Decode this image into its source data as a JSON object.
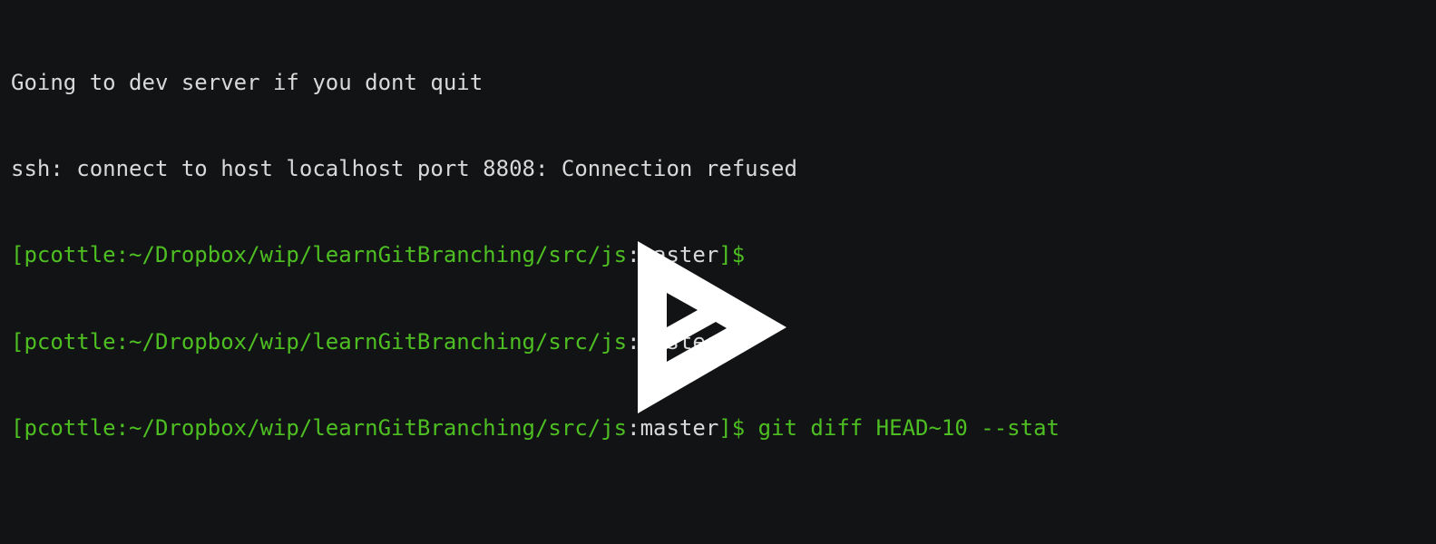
{
  "terminal": {
    "lines": [
      {
        "text": "Going to dev server if you dont quit"
      },
      {
        "text": "ssh: connect to host localhost port 8808: Connection refused"
      },
      {
        "prompt_path": "[pcottle:~/Dropbox/wip/learnGitBranching/src/js",
        "prompt_colon": ":",
        "prompt_branch": "master",
        "prompt_end": "]$",
        "command": ""
      },
      {
        "prompt_path": "[pcottle:~/Dropbox/wip/learnGitBranching/src/js",
        "prompt_colon": ":",
        "prompt_branch": "master",
        "prompt_end": "]$",
        "command": ""
      },
      {
        "prompt_path": "[pcottle:~/Dropbox/wip/learnGitBranching/src/js",
        "prompt_colon": ":",
        "prompt_branch": "master",
        "prompt_end": "]$",
        "command": " git diff HEAD~10 --stat"
      }
    ]
  },
  "overlay": {
    "icon": "asciinema-play-icon"
  },
  "colors": {
    "background": "#121314",
    "text": "#d9d9d9",
    "prompt": "#4ebf22",
    "icon": "#ffffff"
  }
}
